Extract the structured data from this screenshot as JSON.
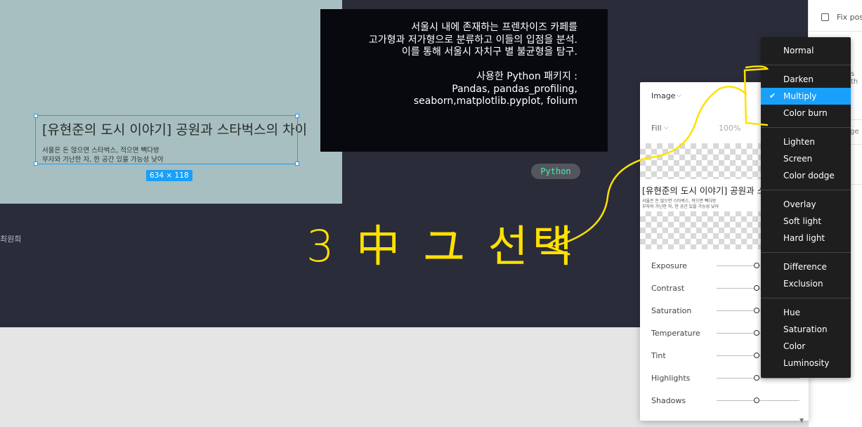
{
  "canvas": {
    "selected_text_title": "[유현준의 도시 이야기] 공원과 스타벅스의 차이",
    "selected_text_desc": "서울은 돈 많으면 스타벅스, 적으면 빽다방\n부자와 가난한 자, 한 공간 있을 가능성 낮아",
    "size_badge": "634 × 118",
    "member_text": "최원희",
    "description_text": "서울시 내에 존재하는 프렌차이즈 카페를\n고가형과 저가형으로 분류하고 이들의 입점을 분석.\n이를 통해 서울시 자치구 별 불균형을 탐구.\n\n사용한 Python 패키지 :\nPandas, pandas_profiling,\nseaborn,matplotlib.pyplot, folium",
    "python_badge": "Python",
    "annotation_handwriting": "3 中 ユ 선택",
    "colors": {
      "teal": "#a7bfc0",
      "dark": "#2a2c3a",
      "accent": "#18a0fb",
      "annotation": "#ffe100",
      "badge_text": "#3ff0b3"
    }
  },
  "right_sidebar": {
    "fix_position_label": "Fix pos",
    "partial_text_1": "s th",
    "partial_text_2": "ge"
  },
  "image_panel": {
    "title": "Image",
    "fill_label": "Fill",
    "fill_percent": "100%",
    "preview_title": "[유현준의 도시 이야기] 공원과 스타",
    "preview_desc": "서울은 돈 많으면 스타벅스, 적으면 빽다방\n부자와 가난한 자, 한 공간 있을 가능성 낮아",
    "adjustments": [
      {
        "label": "Exposure",
        "value": 0
      },
      {
        "label": "Contrast",
        "value": 0
      },
      {
        "label": "Saturation",
        "value": 0
      },
      {
        "label": "Temperature",
        "value": 0
      },
      {
        "label": "Tint",
        "value": 0
      },
      {
        "label": "Highlights",
        "value": 0
      },
      {
        "label": "Shadows",
        "value": 0
      }
    ]
  },
  "blend_menu": {
    "selected": "Multiply",
    "groups": [
      [
        "Normal"
      ],
      [
        "Darken",
        "Multiply",
        "Color burn"
      ],
      [
        "Lighten",
        "Screen",
        "Color dodge"
      ],
      [
        "Overlay",
        "Soft light",
        "Hard light"
      ],
      [
        "Difference",
        "Exclusion"
      ],
      [
        "Hue",
        "Saturation",
        "Color",
        "Luminosity"
      ]
    ],
    "check_icon": "check-icon"
  }
}
